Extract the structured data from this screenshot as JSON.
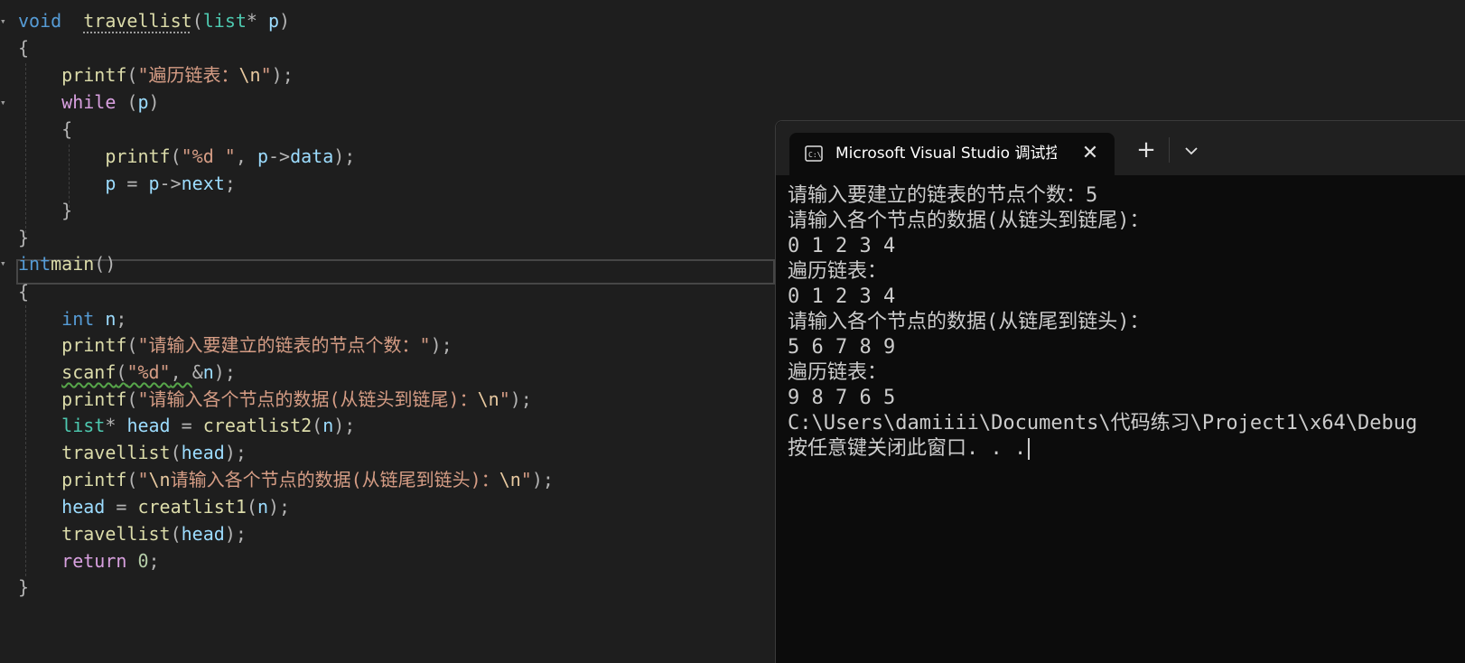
{
  "editor": {
    "lines": [
      {
        "parts": [
          [
            "kw",
            "void"
          ],
          [
            "",
            "  "
          ],
          [
            "fn dots",
            "travellist"
          ],
          [
            "pun",
            "("
          ],
          [
            "ty",
            "list"
          ],
          [
            "pun",
            "* "
          ],
          [
            "var",
            "p"
          ],
          [
            "pun",
            ")"
          ]
        ]
      },
      {
        "parts": [
          [
            "pun",
            "{"
          ]
        ]
      },
      {
        "parts": [
          [
            "",
            "    "
          ],
          [
            "fn",
            "printf"
          ],
          [
            "pun",
            "("
          ],
          [
            "str",
            "\"遍历链表："
          ],
          [
            "esc",
            "\\n"
          ],
          [
            "str",
            "\""
          ],
          [
            "pun",
            ");"
          ]
        ]
      },
      {
        "parts": [
          [
            "",
            "    "
          ],
          [
            "ctl",
            "while"
          ],
          [
            "pun",
            " ("
          ],
          [
            "var",
            "p"
          ],
          [
            "pun",
            ")"
          ]
        ]
      },
      {
        "parts": [
          [
            "",
            "    "
          ],
          [
            "pun",
            "{"
          ]
        ]
      },
      {
        "parts": [
          [
            "",
            "        "
          ],
          [
            "fn",
            "printf"
          ],
          [
            "pun",
            "("
          ],
          [
            "str",
            "\"%d \""
          ],
          [
            "pun",
            ", "
          ],
          [
            "var",
            "p"
          ],
          [
            "pun",
            "->"
          ],
          [
            "var",
            "data"
          ],
          [
            "pun",
            ");"
          ]
        ]
      },
      {
        "parts": [
          [
            "",
            "        "
          ],
          [
            "var",
            "p"
          ],
          [
            "pun",
            " = "
          ],
          [
            "var",
            "p"
          ],
          [
            "pun",
            "->"
          ],
          [
            "var",
            "next"
          ],
          [
            "pun",
            ";"
          ]
        ]
      },
      {
        "parts": [
          [
            "",
            "    "
          ],
          [
            "pun",
            "}"
          ]
        ]
      },
      {
        "parts": [
          [
            "pun",
            "}"
          ]
        ]
      },
      {
        "parts": [
          [
            "kw",
            "int"
          ],
          [
            "",
            "",
            " "
          ],
          [
            "fn",
            "main"
          ],
          [
            "pun",
            "()"
          ]
        ]
      },
      {
        "parts": [
          [
            "pun",
            "{"
          ]
        ]
      },
      {
        "parts": [
          [
            "",
            "    "
          ],
          [
            "kw",
            "int"
          ],
          [
            "pun",
            " "
          ],
          [
            "var",
            "n"
          ],
          [
            "pun",
            ";"
          ]
        ]
      },
      {
        "parts": [
          [
            "",
            "    "
          ],
          [
            "fn",
            "printf"
          ],
          [
            "pun",
            "("
          ],
          [
            "str",
            "\"请输入要建立的链表的节点个数：\""
          ],
          [
            "pun",
            ");"
          ]
        ]
      },
      {
        "parts": [
          [
            "",
            "    "
          ],
          [
            "fn squig",
            "scanf"
          ],
          [
            "pun squig",
            "("
          ],
          [
            "str squig",
            "\"%d\""
          ],
          [
            "pun squig",
            ", "
          ],
          [
            "pun",
            "&"
          ],
          [
            "var",
            "n"
          ],
          [
            "pun",
            ");"
          ]
        ]
      },
      {
        "parts": [
          [
            "",
            "    "
          ],
          [
            "fn",
            "printf"
          ],
          [
            "pun",
            "("
          ],
          [
            "str",
            "\"请输入各个节点的数据(从链头到链尾)："
          ],
          [
            "esc",
            "\\n"
          ],
          [
            "str",
            "\""
          ],
          [
            "pun",
            ");"
          ]
        ]
      },
      {
        "parts": [
          [
            "",
            "    "
          ],
          [
            "ty",
            "list"
          ],
          [
            "pun",
            "* "
          ],
          [
            "var",
            "head"
          ],
          [
            "pun",
            " = "
          ],
          [
            "fn",
            "creatlist2"
          ],
          [
            "pun",
            "("
          ],
          [
            "var",
            "n"
          ],
          [
            "pun",
            ");"
          ]
        ]
      },
      {
        "parts": [
          [
            "",
            "    "
          ],
          [
            "fn",
            "travellist"
          ],
          [
            "pun",
            "("
          ],
          [
            "var",
            "head"
          ],
          [
            "pun",
            ");"
          ]
        ]
      },
      {
        "parts": [
          [
            "",
            "    "
          ],
          [
            "fn",
            "printf"
          ],
          [
            "pun",
            "("
          ],
          [
            "str",
            "\""
          ],
          [
            "esc",
            "\\n"
          ],
          [
            "str",
            "请输入各个节点的数据(从链尾到链头)："
          ],
          [
            "esc",
            "\\n"
          ],
          [
            "str",
            "\""
          ],
          [
            "pun",
            ");"
          ]
        ]
      },
      {
        "parts": [
          [
            "",
            "    "
          ],
          [
            "var",
            "head"
          ],
          [
            "pun",
            " = "
          ],
          [
            "fn",
            "creatlist1"
          ],
          [
            "pun",
            "("
          ],
          [
            "var",
            "n"
          ],
          [
            "pun",
            ");"
          ]
        ]
      },
      {
        "parts": [
          [
            "",
            "    "
          ],
          [
            "fn",
            "travellist"
          ],
          [
            "pun",
            "("
          ],
          [
            "var",
            "head"
          ],
          [
            "pun",
            ");"
          ]
        ]
      },
      {
        "parts": [
          [
            "",
            "    "
          ],
          [
            "ctl",
            "return"
          ],
          [
            "pun",
            " "
          ],
          [
            "num",
            "0"
          ],
          [
            "pun",
            ";"
          ]
        ]
      },
      {
        "parts": [
          [
            "pun",
            "}"
          ]
        ]
      }
    ]
  },
  "terminal": {
    "tab_title": "Microsoft Visual Studio 调试控制台",
    "tab_icon": "terminal-icon",
    "close_icon": "close-icon",
    "new_tab_icon": "plus-icon",
    "dropdown_icon": "chevron-down-icon",
    "output": [
      "请输入要建立的链表的节点个数：5",
      "请输入各个节点的数据(从链头到链尾)：",
      "0 1 2 3 4",
      "遍历链表：",
      "0 1 2 3 4",
      "请输入各个节点的数据(从链尾到链头)：",
      "5 6 7 8 9",
      "遍历链表：",
      "9 8 7 6 5",
      "C:\\Users\\damiiii\\Documents\\代码练习\\Project1\\x64\\Debug",
      "按任意键关闭此窗口. . ."
    ]
  }
}
